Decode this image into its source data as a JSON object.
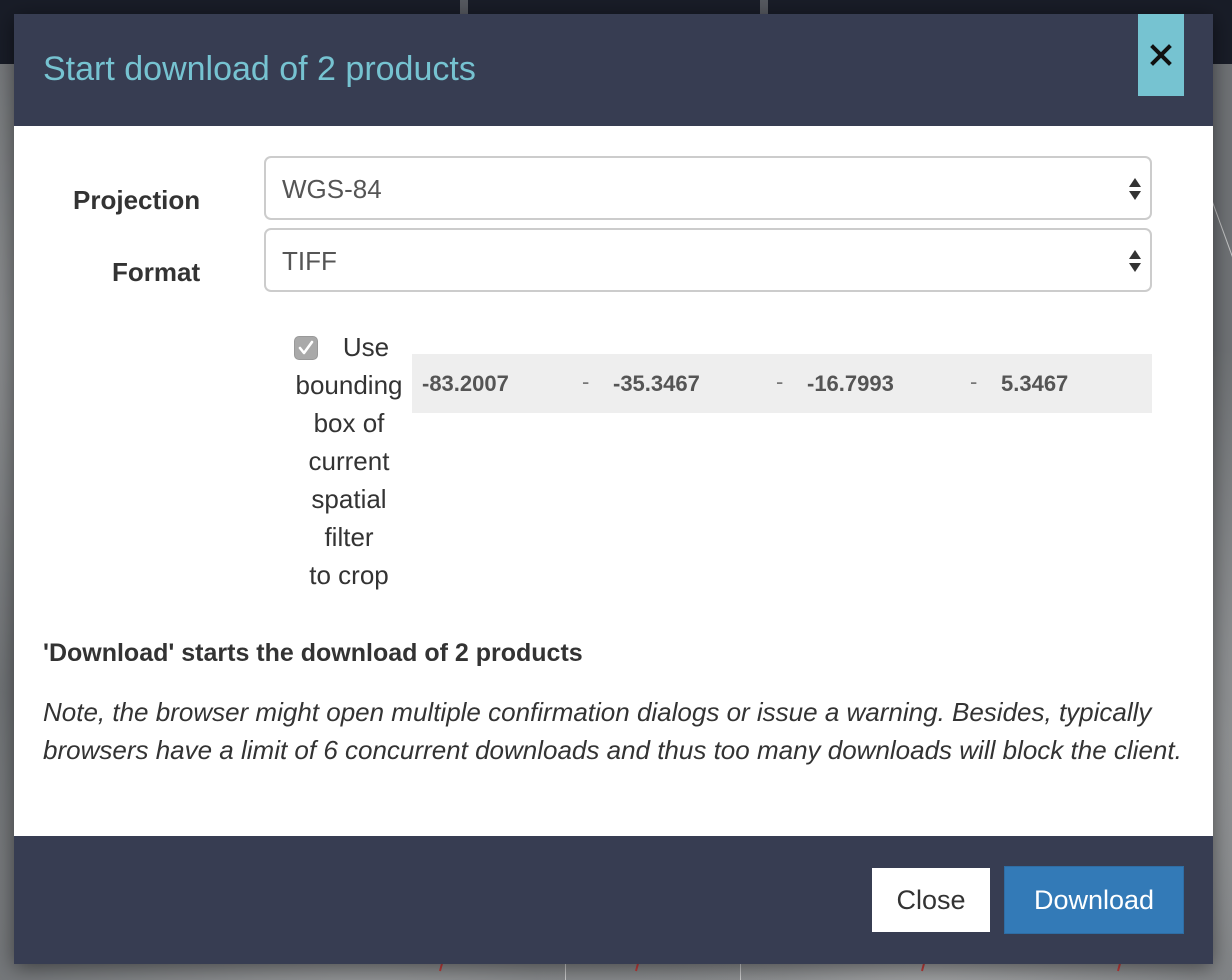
{
  "modal": {
    "title": "Start download of 2 products",
    "close_icon": "close-icon"
  },
  "form": {
    "projection": {
      "label": "Projection",
      "value": "WGS-84"
    },
    "format": {
      "label": "Format",
      "value": "TIFF"
    },
    "crop": {
      "checked": true,
      "label_lines": [
        "Use",
        "bounding",
        "box of",
        "current",
        "spatial",
        "filter",
        "to crop"
      ],
      "bbox": [
        "-83.2007",
        "-35.3467",
        "-16.7993",
        "5.3467"
      ],
      "separator": "-"
    }
  },
  "summary": "'Download' starts the download of 2 products",
  "note": "Note, the browser might open multiple confirmation dialogs or issue a warning. Besides, typically browsers have a limit of 6 concurrent downloads and thus too many downloads will block the client.",
  "footer": {
    "close_label": "Close",
    "download_label": "Download"
  },
  "colors": {
    "header_bg": "#373d52",
    "title": "#76c3d1",
    "primary": "#337ab7"
  }
}
